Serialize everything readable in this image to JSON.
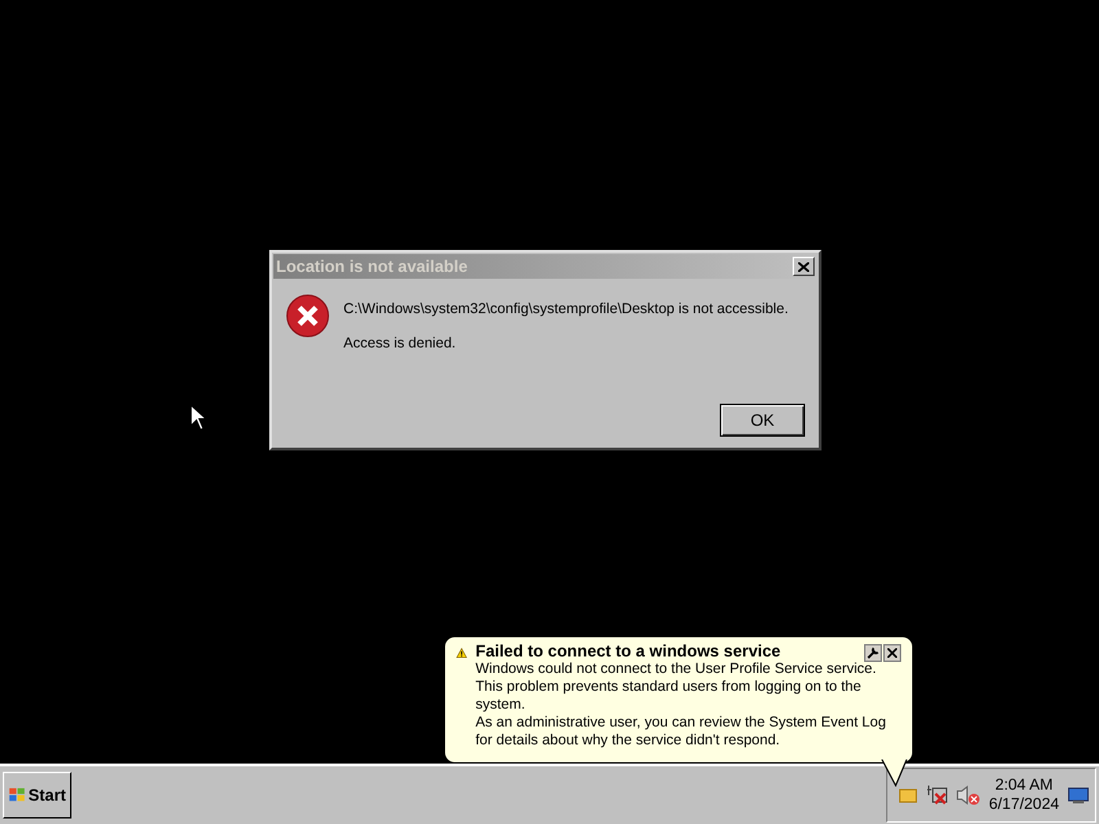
{
  "dialog": {
    "title": "Location is not available",
    "messages": [
      "C:\\Windows\\system32\\config\\systemprofile\\Desktop is not accessible.",
      "Access is denied."
    ],
    "buttons": [
      "OK"
    ]
  },
  "balloon": {
    "title": "Failed to connect to a windows service",
    "lines": [
      "Windows could not connect to the User Profile Service service. This problem prevents standard users from logging on to the system.",
      "As an administrative user, you can review the System Event Log for details about why the service didn't respond."
    ]
  },
  "taskbar": {
    "start_label": "Start",
    "clock": {
      "time": "2:04 AM",
      "date": "6/17/2024"
    }
  }
}
